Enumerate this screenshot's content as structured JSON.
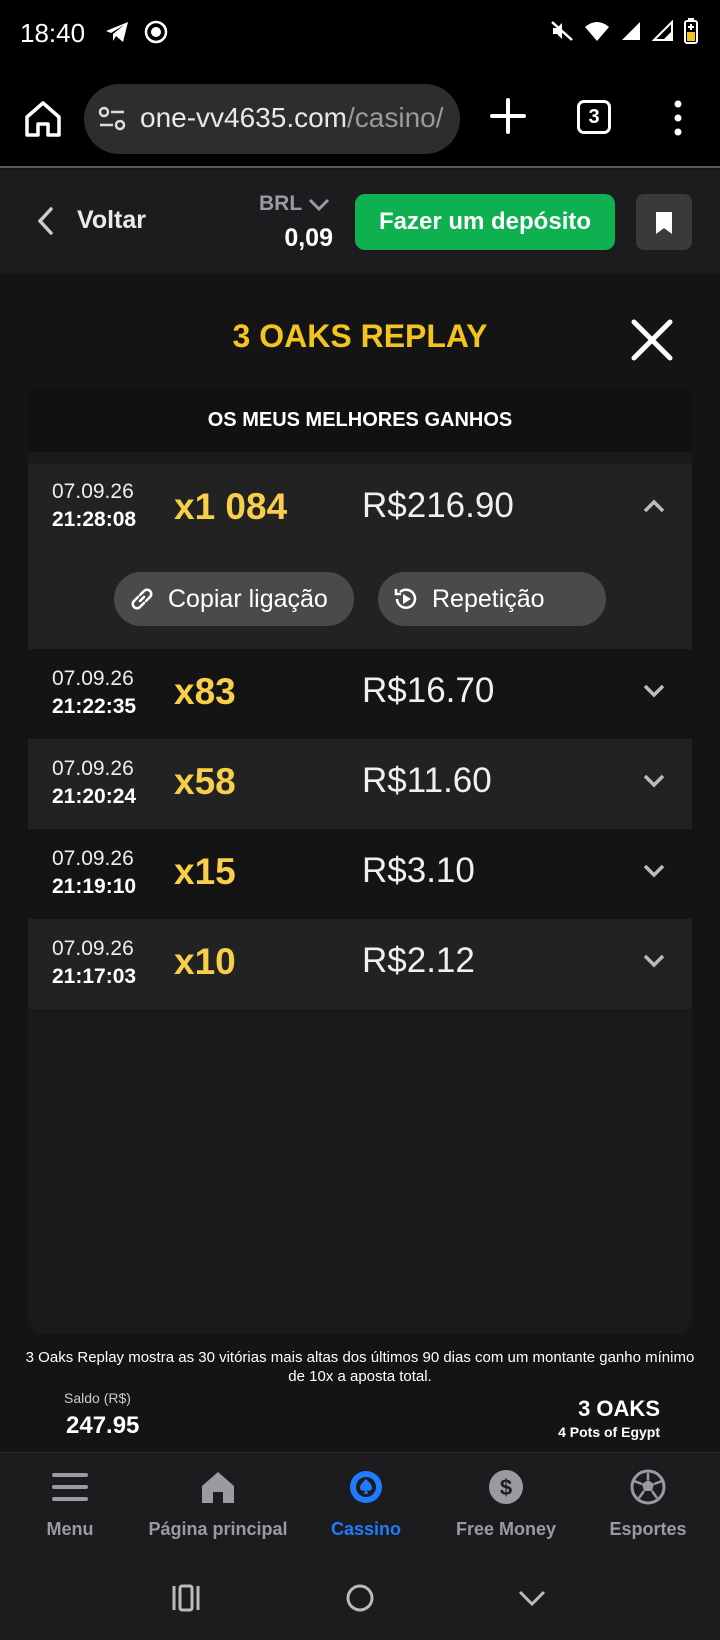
{
  "status_bar": {
    "time": "18:40"
  },
  "browser": {
    "url_main": "one-vv4635.com",
    "url_path": "/casino/",
    "tab_count": "3"
  },
  "header": {
    "back_label": "Voltar",
    "currency": "BRL",
    "balance": "0,09",
    "deposit_label": "Fazer um depósito"
  },
  "replay": {
    "title": "3 OAKS REPLAY",
    "panel_title": "OS MEUS MELHORES GANHOS",
    "copy_link_label": "Copiar ligação",
    "replay_label": "Repetição",
    "wins": [
      {
        "date": "07.09.26",
        "time": "21:28:08",
        "multiplier": "x1 084",
        "amount": "R$216.90"
      },
      {
        "date": "07.09.26",
        "time": "21:22:35",
        "multiplier": "x83",
        "amount": "R$16.70"
      },
      {
        "date": "07.09.26",
        "time": "21:20:24",
        "multiplier": "x58",
        "amount": "R$11.60"
      },
      {
        "date": "07.09.26",
        "time": "21:19:10",
        "multiplier": "x15",
        "amount": "R$3.10"
      },
      {
        "date": "07.09.26",
        "time": "21:17:03",
        "multiplier": "x10",
        "amount": "R$2.12"
      }
    ],
    "footnote": "3 Oaks Replay mostra as 30 vitórias mais altas dos últimos 90 dias com um montante ganho mínimo de 10x a aposta total."
  },
  "game_footer": {
    "saldo_label": "Saldo (R$)",
    "saldo_value": "247.95",
    "provider": "3 OAKS",
    "game": "4 Pots of Egypt"
  },
  "bottom_nav": {
    "items": [
      {
        "label": "Menu",
        "icon": "menu-icon"
      },
      {
        "label": "Página principal",
        "icon": "home-icon"
      },
      {
        "label": "Cassino",
        "icon": "casino-chip-icon"
      },
      {
        "label": "Free Money",
        "icon": "dollar-icon"
      },
      {
        "label": "Esportes",
        "icon": "soccer-ball-icon"
      }
    ],
    "active": "Cassino",
    "active_color": "#1f7bff"
  },
  "colors": {
    "accent_yellow": "#f5c31d",
    "deposit_green": "#0eb04f"
  }
}
